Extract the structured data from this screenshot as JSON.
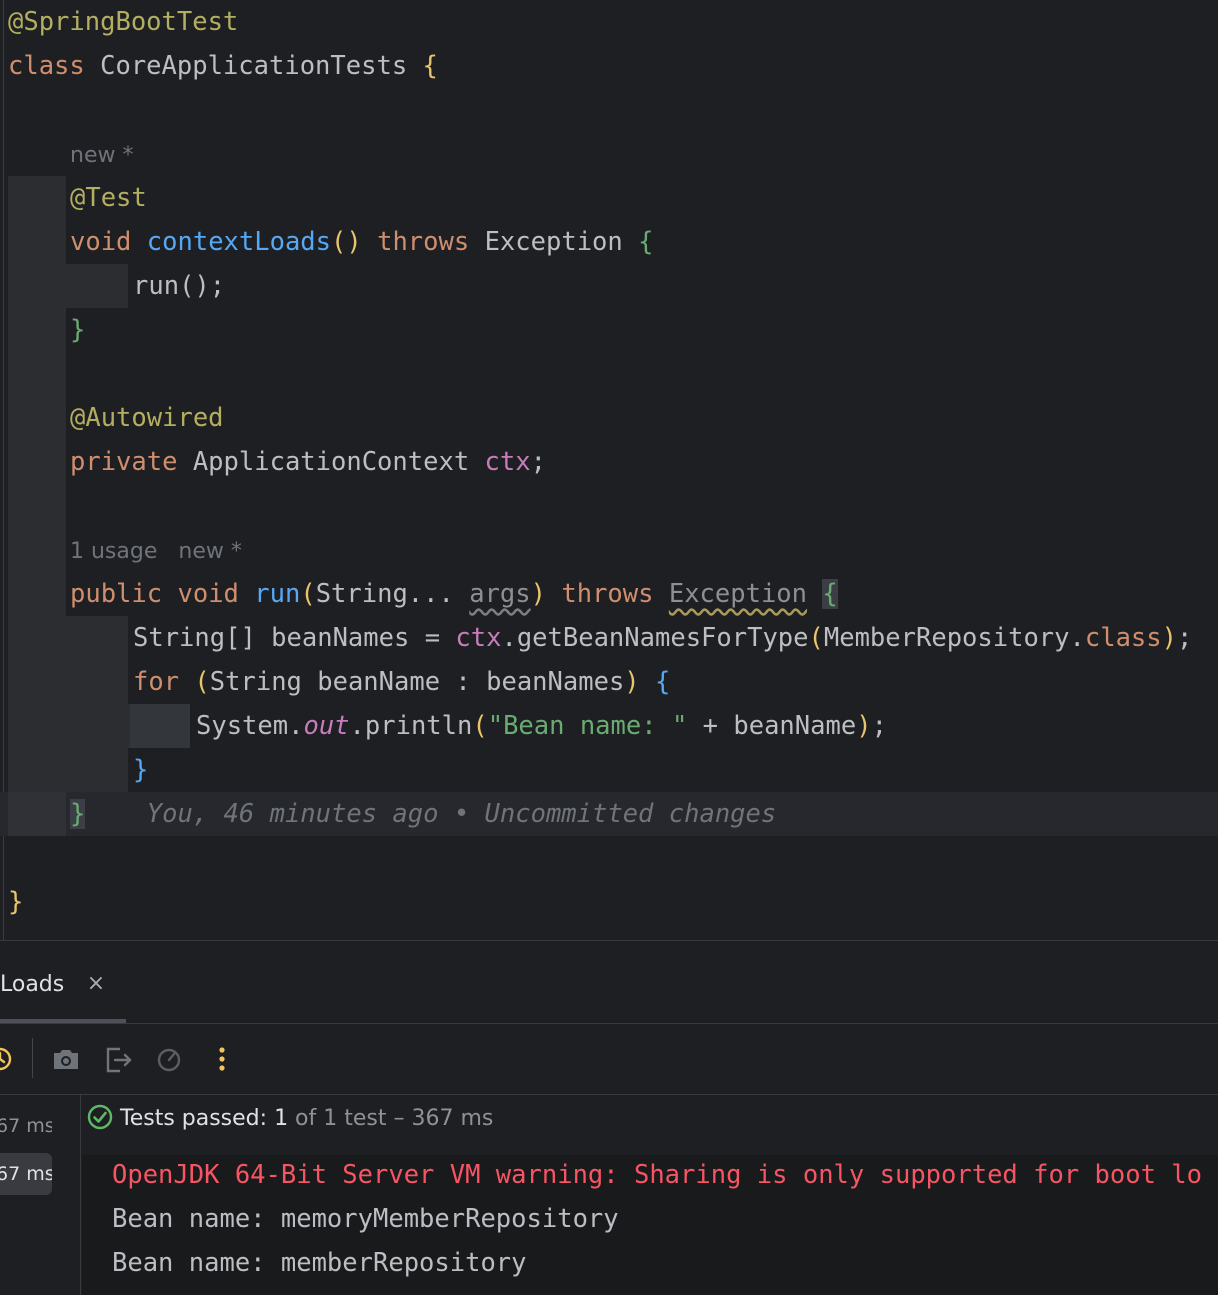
{
  "editor": {
    "lines": {
      "l1": "@SpringBootTest",
      "l2_kw": "class",
      "l2_name": "CoreApplicationTests",
      "l2_brace": "{",
      "hint1": "new *",
      "l4": "@Test",
      "l5_void": "void",
      "l5_name": "contextLoads",
      "l5_parens": "()",
      "l5_throws": "throws",
      "l5_exc": "Exception",
      "l5_brace": "{",
      "l6_call": "run",
      "l6_rest": "();",
      "l7_brace": "}",
      "l9": "@Autowired",
      "l10_kw": "private",
      "l10_type": "ApplicationContext",
      "l10_field": "ctx",
      "l10_end": ";",
      "hint2_usage": "1 usage",
      "hint2_new": "new *",
      "l12_public": "public",
      "l12_void": "void",
      "l12_name": "run",
      "l12_open": "(",
      "l12_type": "String...",
      "l12_args": "args",
      "l12_close": ")",
      "l12_throws": "throws",
      "l12_exc": "Exception",
      "l12_brace": "{",
      "l13_a": "String[] beanNames = ",
      "l13_ctx": "ctx",
      "l13_b": ".getBeanNamesForType",
      "l13_open": "(",
      "l13_c": "MemberRepository.",
      "l13_class": "class",
      "l13_close": ")",
      "l13_end": ";",
      "l14_for": "for",
      "l14_open": "(",
      "l14_mid": "String beanName : beanNames",
      "l14_close": ")",
      "l14_brace": "{",
      "l15_a": "System.",
      "l15_out": "out",
      "l15_b": ".println",
      "l15_open": "(",
      "l15_str": "\"Bean name: \"",
      "l15_c": " + beanName",
      "l15_close": ")",
      "l15_end": ";",
      "l16_brace": "}",
      "l17_brace": "}",
      "l17_blame": "You, 46 minutes ago • Uncommitted changes",
      "l19_brace": "}"
    }
  },
  "run_panel": {
    "tab_label": "Loads",
    "tab_close": "×",
    "toolbar_icons": [
      "history-icon",
      "camera-icon",
      "exit-icon",
      "gauge-icon",
      "more-icon"
    ],
    "tree": [
      "67 ms",
      "67 ms"
    ],
    "status": {
      "prefix": "Tests passed: ",
      "count": "1",
      "suffix": " of 1 test – 367 ms"
    },
    "console": [
      "OpenJDK 64-Bit Server VM warning: Sharing is only supported for boot lo",
      "Bean name: memoryMemberRepository",
      "Bean name: memberRepository"
    ],
    "colors": {
      "pass": "#5fb865",
      "error": "#f75464",
      "accent": "#f2c55c"
    }
  }
}
